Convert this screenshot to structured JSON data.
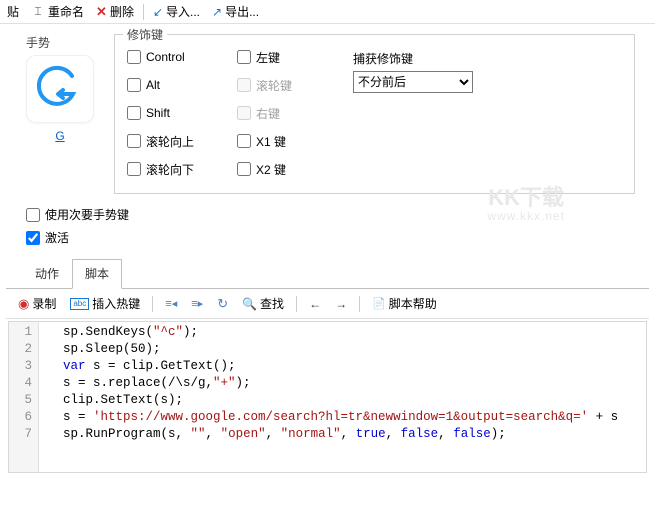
{
  "toolbar": {
    "paste": "贴",
    "rename": "重命名",
    "delete": "删除",
    "import": "导入...",
    "export": "导出..."
  },
  "gesture": {
    "label": "手势",
    "name": "G"
  },
  "modifiers": {
    "legend": "修饰键",
    "control": "Control",
    "alt": "Alt",
    "shift": "Shift",
    "wheelUp": "滚轮向上",
    "wheelDown": "滚轮向下",
    "leftBtn": "左键",
    "wheelBtn": "滚轮键",
    "rightBtn": "右键",
    "x1": "X1 键",
    "x2": "X2 键",
    "captureLabel": "捕获修饰键",
    "captureValue": "不分前后"
  },
  "bottom": {
    "useSecondary": "使用次要手势键",
    "activate": "激活"
  },
  "watermark": {
    "main": "KK下载",
    "sub": "www.kkx.net"
  },
  "tabs": {
    "actions": "动作",
    "script": "脚本"
  },
  "scriptbar": {
    "record": "录制",
    "insertHotkey": "插入热键",
    "search": "查找",
    "scriptHelp": "脚本帮助"
  },
  "code": {
    "lines": [
      {
        "n": 1,
        "pre": "sp.SendKeys(",
        "q": "\"^c\"",
        "post": ");"
      },
      {
        "n": 2,
        "pre": "sp.Sleep(50);",
        "q": "",
        "post": ""
      },
      {
        "n": 3,
        "pre": "",
        "kw": "var",
        "mid": " s = clip.GetText();",
        "q": "",
        "post": ""
      },
      {
        "n": 4,
        "pre": "s = s.replace(/\\s/g,",
        "q": "\"+\"",
        "post": ");"
      },
      {
        "n": 5,
        "pre": "clip.SetText(s);",
        "q": "",
        "post": ""
      },
      {
        "n": 6,
        "pre": "s = ",
        "q": "'https://www.google.com/search?hl=tr&newwindow=1&output=search&q='",
        "post": " + s"
      },
      {
        "n": 7,
        "pre": "sp.RunProgram(s, ",
        "q2a": "\"\"",
        "mid": ", ",
        "q2b": "\"open\"",
        "mid2": ", ",
        "q2c": "\"normal\"",
        "post": ", ",
        "kw2a": "true",
        "post2": ", ",
        "kw2b": "false",
        "post3": ", ",
        "kw2c": "false",
        "post4": ");"
      }
    ]
  }
}
